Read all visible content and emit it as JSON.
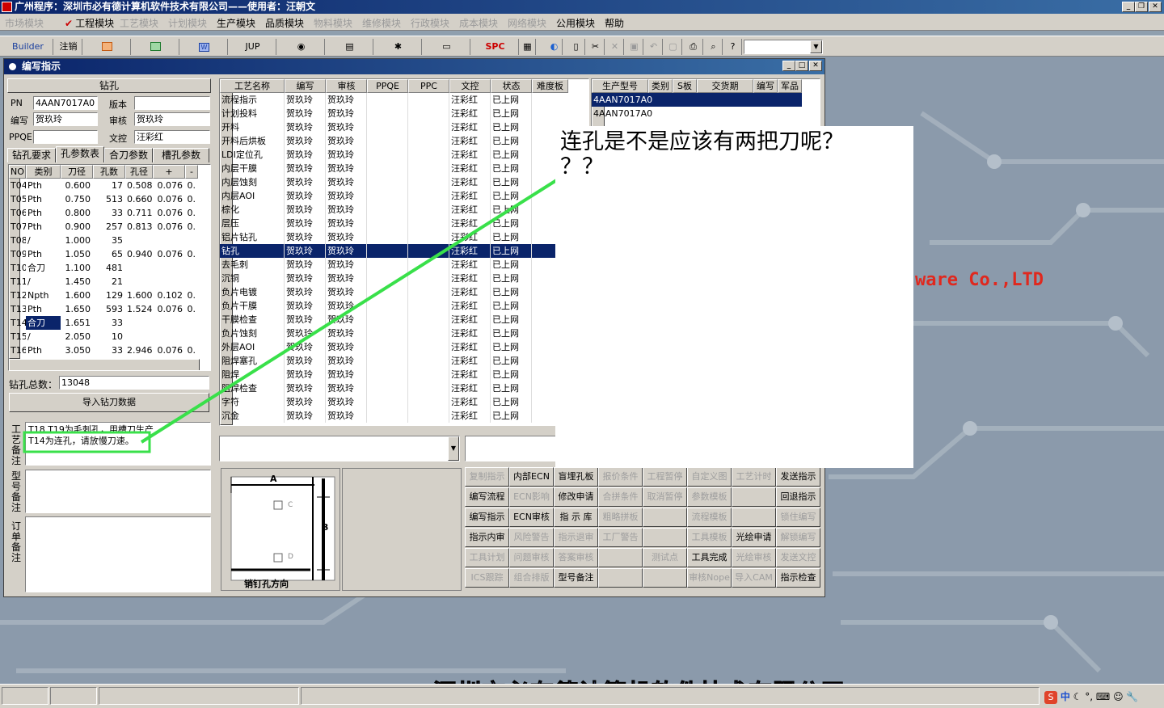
{
  "app": {
    "title": "广州程序：深圳市必有德计算机软件技术有限公司——使用者：汪朝文",
    "watermark_en": "ware  Co.,LTD",
    "watermark_cn": "深圳市必有德计算机软件技术有限公司"
  },
  "menu": [
    {
      "label": "市场模块",
      "enabled": false
    },
    {
      "label": "工程模块",
      "enabled": true,
      "checked": true
    },
    {
      "label": "工艺模块",
      "enabled": false
    },
    {
      "label": "计划模块",
      "enabled": false
    },
    {
      "label": "生产模块",
      "enabled": true
    },
    {
      "label": "品质模块",
      "enabled": true
    },
    {
      "label": "物料模块",
      "enabled": false
    },
    {
      "label": "维修模块",
      "enabled": false
    },
    {
      "label": "行政模块",
      "enabled": false
    },
    {
      "label": "成本模块",
      "enabled": false
    },
    {
      "label": "网络模块",
      "enabled": false
    },
    {
      "label": "公用模块",
      "enabled": true
    },
    {
      "label": "帮助",
      "enabled": true
    }
  ],
  "toolbar": {
    "builder": "Builder",
    "logout": "注销",
    "jup": "JUP",
    "spc": "SPC"
  },
  "window": {
    "title": "编写指示"
  },
  "form": {
    "header": "钻孔",
    "pn_label": "PN",
    "pn_value": "4AAN7017A0",
    "version_label": "版本",
    "version_value": "",
    "writer_label": "编写",
    "writer_value": "贺玖玲",
    "reviewer_label": "审核",
    "reviewer_value": "贺玖玲",
    "ppqe_label": "PPQE",
    "ppqe_value": "",
    "control_label": "文控",
    "control_value": "汪彩红"
  },
  "tabs": [
    "钻孔要求",
    "孔参数表",
    "合刀参数",
    "槽孔参数"
  ],
  "drill_table": {
    "headers": [
      "NO",
      "类别",
      "刀径",
      "孔数",
      "孔径",
      "+",
      "-"
    ],
    "rows": [
      [
        "T04",
        "Pth",
        "0.600",
        "17",
        "0.508",
        "0.076",
        "0."
      ],
      [
        "T05",
        "Pth",
        "0.750",
        "513",
        "0.660",
        "0.076",
        "0."
      ],
      [
        "T06",
        "Pth",
        "0.800",
        "33",
        "0.711",
        "0.076",
        "0."
      ],
      [
        "T07",
        "Pth",
        "0.900",
        "257",
        "0.813",
        "0.076",
        "0."
      ],
      [
        "T08",
        "/",
        "1.000",
        "35",
        "",
        "",
        ""
      ],
      [
        "T09",
        "Pth",
        "1.050",
        "65",
        "0.940",
        "0.076",
        "0."
      ],
      [
        "T10",
        "合刀",
        "1.100",
        "481",
        "",
        "",
        ""
      ],
      [
        "T11",
        "/",
        "1.450",
        "21",
        "",
        "",
        ""
      ],
      [
        "T12",
        "Npth",
        "1.600",
        "129",
        "1.600",
        "0.102",
        "0."
      ],
      [
        "T13",
        "Pth",
        "1.650",
        "593",
        "1.524",
        "0.076",
        "0."
      ],
      [
        "T14",
        "合刀",
        "1.651",
        "33",
        "",
        "",
        ""
      ],
      [
        "T15",
        "/",
        "2.050",
        "10",
        "",
        "",
        ""
      ],
      [
        "T16",
        "Pth",
        "3.050",
        "33",
        "2.946",
        "0.076",
        "0."
      ]
    ],
    "selected_cell": "合刀"
  },
  "drill_total_label": "钻孔总数：",
  "drill_total_value": "13048",
  "import_button": "导入钻刀数据",
  "remarks": {
    "process_label": "工艺备注",
    "process_text_line1": "T18 T19为毛刺孔，用槽刀生产",
    "process_text_line2": "T14为连孔，请放慢刀速。",
    "model_label": "型号备注",
    "order_label": "订单备注"
  },
  "process_table": {
    "headers": [
      "工艺名称",
      "编写",
      "审核",
      "PPQE",
      "PPC",
      "文控",
      "状态",
      "难度板"
    ],
    "rows": [
      [
        "流程指示",
        "贺玖玲",
        "贺玖玲",
        "",
        "",
        "汪彩红",
        "已上网"
      ],
      [
        "计划投料",
        "贺玖玲",
        "贺玖玲",
        "",
        "",
        "汪彩红",
        "已上网"
      ],
      [
        "开料",
        "贺玖玲",
        "贺玖玲",
        "",
        "",
        "汪彩红",
        "已上网"
      ],
      [
        "开料后烘板",
        "贺玖玲",
        "贺玖玲",
        "",
        "",
        "汪彩红",
        "已上网"
      ],
      [
        "LDI定位孔",
        "贺玖玲",
        "贺玖玲",
        "",
        "",
        "汪彩红",
        "已上网"
      ],
      [
        "内层干膜",
        "贺玖玲",
        "贺玖玲",
        "",
        "",
        "汪彩红",
        "已上网"
      ],
      [
        "内层蚀刻",
        "贺玖玲",
        "贺玖玲",
        "",
        "",
        "汪彩红",
        "已上网"
      ],
      [
        "内层AOI",
        "贺玖玲",
        "贺玖玲",
        "",
        "",
        "汪彩红",
        "已上网"
      ],
      [
        "棕化",
        "贺玖玲",
        "贺玖玲",
        "",
        "",
        "汪彩红",
        "已上网"
      ],
      [
        "层压",
        "贺玖玲",
        "贺玖玲",
        "",
        "",
        "汪彩红",
        "已上网"
      ],
      [
        "铝片钻孔",
        "贺玖玲",
        "贺玖玲",
        "",
        "",
        "汪彩红",
        "已上网"
      ],
      [
        "钻孔",
        "贺玖玲",
        "贺玖玲",
        "",
        "",
        "汪彩红",
        "已上网"
      ],
      [
        "去毛刺",
        "贺玖玲",
        "贺玖玲",
        "",
        "",
        "汪彩红",
        "已上网"
      ],
      [
        "沉铜",
        "贺玖玲",
        "贺玖玲",
        "",
        "",
        "汪彩红",
        "已上网"
      ],
      [
        "负片电镀",
        "贺玖玲",
        "贺玖玲",
        "",
        "",
        "汪彩红",
        "已上网"
      ],
      [
        "负片干膜",
        "贺玖玲",
        "贺玖玲",
        "",
        "",
        "汪彩红",
        "已上网"
      ],
      [
        "干膜检查",
        "贺玖玲",
        "贺玖玲",
        "",
        "",
        "汪彩红",
        "已上网"
      ],
      [
        "负片蚀刻",
        "贺玖玲",
        "贺玖玲",
        "",
        "",
        "汪彩红",
        "已上网"
      ],
      [
        "外层AOI",
        "贺玖玲",
        "贺玖玲",
        "",
        "",
        "汪彩红",
        "已上网"
      ],
      [
        "阻焊塞孔",
        "贺玖玲",
        "贺玖玲",
        "",
        "",
        "汪彩红",
        "已上网"
      ],
      [
        "阻焊",
        "贺玖玲",
        "贺玖玲",
        "",
        "",
        "汪彩红",
        "已上网"
      ],
      [
        "阻焊检查",
        "贺玖玲",
        "贺玖玲",
        "",
        "",
        "汪彩红",
        "已上网"
      ],
      [
        "字符",
        "贺玖玲",
        "贺玖玲",
        "",
        "",
        "汪彩红",
        "已上网"
      ],
      [
        "沉金",
        "贺玖玲",
        "贺玖玲",
        "",
        "",
        "汪彩红",
        "已上网"
      ]
    ],
    "selected_row": 11
  },
  "model_table": {
    "headers": [
      "生产型号",
      "类别",
      "S板",
      "交货期",
      "编写",
      "军品"
    ],
    "rows": [
      [
        "4AAN7017A0"
      ],
      [
        "4AAN7017A0"
      ]
    ]
  },
  "pin_diagram": {
    "label_a": "A",
    "label_b": "B",
    "label_c": "C",
    "label_d": "D",
    "caption": "销钉孔方向"
  },
  "buttons": [
    [
      "复制指示",
      "内部ECN",
      "盲埋孔板",
      "报价条件",
      "工程暂停",
      "自定义图",
      "工艺计时",
      "发送指示"
    ],
    [
      "编写流程",
      "ECN影响",
      "修改申请",
      "合拼条件",
      "取消暂停",
      "参数模板",
      "",
      "回退指示"
    ],
    [
      "编写指示",
      "ECN审核",
      "指 示 库",
      "粗略拼板",
      "",
      "流程模板",
      "",
      "锁住编写"
    ],
    [
      "指示内审",
      "风险警告",
      "指示退审",
      "工厂警告",
      "",
      "工具模板",
      "光绘申请",
      "解锁编写"
    ],
    [
      "工具计划",
      "问题审核",
      "答案审核",
      "",
      "测试点",
      "工具完成",
      "光绘审核",
      "发送文控"
    ],
    [
      "ICS跟踪",
      "组合排版",
      "型号备注",
      "",
      "",
      "审核Nope",
      "导入CAM",
      "指示检查"
    ]
  ],
  "buttons_enabled": [
    [
      false,
      true,
      true,
      false,
      false,
      false,
      false,
      true
    ],
    [
      true,
      false,
      true,
      false,
      false,
      false,
      false,
      true
    ],
    [
      true,
      true,
      true,
      false,
      false,
      false,
      false,
      false
    ],
    [
      true,
      false,
      false,
      false,
      false,
      false,
      true,
      false
    ],
    [
      false,
      false,
      false,
      false,
      false,
      true,
      false,
      false
    ],
    [
      false,
      false,
      true,
      false,
      false,
      false,
      false,
      true
    ]
  ],
  "callout": {
    "line1": "连孔是不是应该有两把刀呢？",
    "line2": "？？"
  },
  "tray": {
    "ime": "中"
  }
}
